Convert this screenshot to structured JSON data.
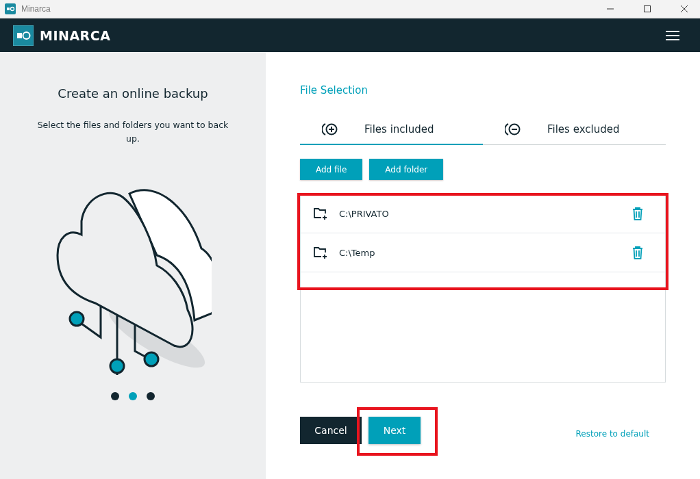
{
  "window": {
    "title": "Minarca"
  },
  "header": {
    "brand": "MINARCA"
  },
  "intro": {
    "title": "Create an online backup",
    "text": "Select the files and folders you want to back up."
  },
  "carousel": [
    {
      "selected": false
    },
    {
      "selected": true
    },
    {
      "selected": false
    }
  ],
  "section_title": "File Selection",
  "tabs": [
    {
      "label": "Files included",
      "kind": "include",
      "selected": true
    },
    {
      "label": "Files excluded",
      "kind": "exclude",
      "selected": false
    }
  ],
  "actions": [
    "Add file",
    "Add folder"
  ],
  "items": [
    {
      "path": "C:\\PRIVATO"
    },
    {
      "path": "C:\\Temp"
    }
  ],
  "footer": {
    "cancel": "Cancel",
    "next": "Next",
    "restore": "Restore to default"
  }
}
